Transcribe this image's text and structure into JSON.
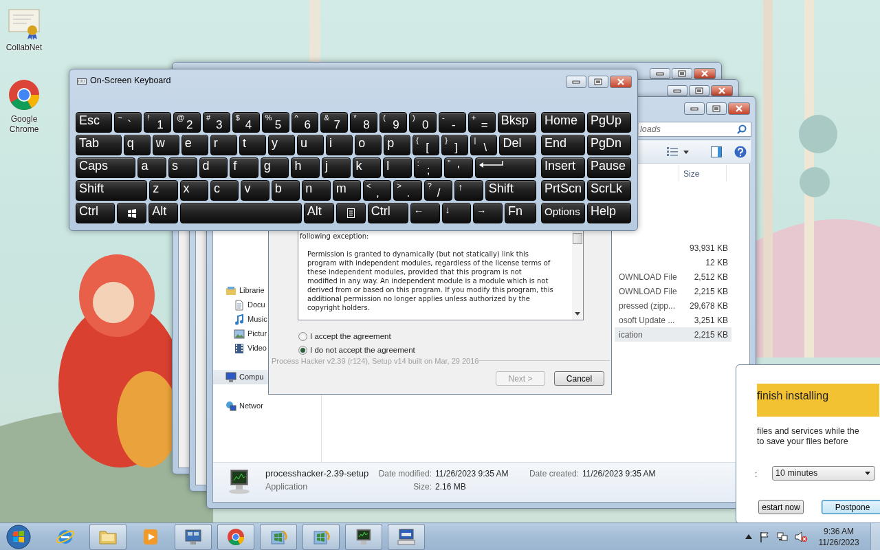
{
  "desktop_icons": [
    {
      "label": "CollabNet",
      "kind": "certificate"
    },
    {
      "label": "Google Chrome",
      "kind": "browser"
    }
  ],
  "explorer": {
    "search": {
      "value": "loads"
    },
    "column_header": "Size",
    "nav_items": [
      {
        "label": "Librarie",
        "kind": "library",
        "selected": false
      },
      {
        "label": "Docu",
        "kind": "document",
        "selected": false
      },
      {
        "label": "Music",
        "kind": "music",
        "selected": false
      },
      {
        "label": "Pictur",
        "kind": "picture",
        "selected": false
      },
      {
        "label": "Video",
        "kind": "video",
        "selected": false
      },
      {
        "label": "Compu",
        "kind": "computer",
        "selected": true
      },
      {
        "label": "Networ",
        "kind": "network",
        "selected": false
      }
    ],
    "files": [
      {
        "size": "93,931 KB",
        "selected": false
      },
      {
        "size": "12 KB",
        "selected": false
      },
      {
        "type": "OWNLOAD File",
        "size": "2,512 KB",
        "selected": false
      },
      {
        "type": "OWNLOAD File",
        "size": "2,215 KB",
        "selected": false
      },
      {
        "type": "pressed (zipp...",
        "size": "29,678 KB",
        "selected": false
      },
      {
        "type": "osoft Update ...",
        "size": "3,251 KB",
        "selected": false
      },
      {
        "type": "ication",
        "size": "2,215 KB",
        "selected": true
      }
    ],
    "details": {
      "name": "processhacker-2.39-setup",
      "type": "Application",
      "modified_label": "Date modified:",
      "modified": "11/26/2023 9:35 AM",
      "size_label": "Size:",
      "size": "2.16 MB",
      "created_label": "Date created:",
      "created": "11/26/2023 9:35 AM"
    }
  },
  "setup": {
    "license_intro": "following exception:",
    "license_text": "Permission is granted to dynamically (but not statically) link this program with independent modules, regardless of the license terms of these independent modules, provided that this program is not modified in any way. An independent module is a module which is not derived from or based on this program. If you modify this program, this additional permission no longer applies unless authorized by the copyright holders.",
    "options": [
      {
        "label": "I accept the agreement",
        "selected": false
      },
      {
        "label": "I do not accept the agreement",
        "selected": true
      }
    ],
    "version": "Process Hacker v2.39 (r124), Setup v14 built on Mar, 29 2016",
    "buttons": [
      {
        "label": "Next >",
        "disabled": true
      },
      {
        "label": "Cancel",
        "disabled": false
      }
    ]
  },
  "update": {
    "heading": "finish installing",
    "body_lines": [
      "files and services while the",
      "to save your files before"
    ],
    "select_label": ":",
    "select": "10 minutes",
    "buttons": [
      {
        "label": "estart now",
        "focused": false
      },
      {
        "label": "Postpone",
        "focused": true
      }
    ]
  },
  "keyboard": {
    "title": "On-Screen Keyboard",
    "main_rows": [
      [
        {
          "kind": "text",
          "label": "Esc"
        },
        {
          "kind": "dual",
          "shift": "~",
          "label": "`"
        },
        {
          "kind": "dual",
          "shift": "!",
          "label": "1"
        },
        {
          "kind": "dual",
          "shift": "@",
          "label": "2"
        },
        {
          "kind": "dual",
          "shift": "#",
          "label": "3"
        },
        {
          "kind": "dual",
          "shift": "$",
          "label": "4"
        },
        {
          "kind": "dual",
          "shift": "%",
          "label": "5"
        },
        {
          "kind": "dual",
          "shift": "^",
          "label": "6"
        },
        {
          "kind": "dual",
          "shift": "&",
          "label": "7"
        },
        {
          "kind": "dual",
          "shift": "*",
          "label": "8"
        },
        {
          "kind": "dual",
          "shift": "(",
          "label": "9"
        },
        {
          "kind": "dual",
          "shift": ")",
          "label": "0"
        },
        {
          "kind": "dual",
          "shift": "-",
          "label": "-"
        },
        {
          "kind": "dual",
          "shift": "+",
          "label": "="
        },
        {
          "kind": "text",
          "label": "Bksp"
        }
      ],
      [
        {
          "kind": "text",
          "label": "Tab"
        },
        {
          "kind": "text",
          "label": "q"
        },
        {
          "kind": "text",
          "label": "w"
        },
        {
          "kind": "text",
          "label": "e"
        },
        {
          "kind": "text",
          "label": "r"
        },
        {
          "kind": "text",
          "label": "t"
        },
        {
          "kind": "text",
          "label": "y"
        },
        {
          "kind": "text",
          "label": "u"
        },
        {
          "kind": "text",
          "label": "i"
        },
        {
          "kind": "text",
          "label": "o"
        },
        {
          "kind": "text",
          "label": "p"
        },
        {
          "kind": "dual",
          "shift": "{",
          "label": "["
        },
        {
          "kind": "dual",
          "shift": "}",
          "label": "]"
        },
        {
          "kind": "dual",
          "shift": "|",
          "label": "\\"
        },
        {
          "kind": "text",
          "label": "Del"
        }
      ],
      [
        {
          "kind": "text",
          "label": "Caps"
        },
        {
          "kind": "text",
          "label": "a"
        },
        {
          "kind": "text",
          "label": "s"
        },
        {
          "kind": "text",
          "label": "d"
        },
        {
          "kind": "text",
          "label": "f"
        },
        {
          "kind": "text",
          "label": "g"
        },
        {
          "kind": "text",
          "label": "h"
        },
        {
          "kind": "text",
          "label": "j"
        },
        {
          "kind": "text",
          "label": "k"
        },
        {
          "kind": "text",
          "label": "l"
        },
        {
          "kind": "dual",
          "shift": ":",
          "label": ";"
        },
        {
          "kind": "dual",
          "shift": "\"",
          "label": "'"
        },
        {
          "kind": "enter"
        }
      ],
      [
        {
          "kind": "text",
          "label": "Shift"
        },
        {
          "kind": "text",
          "label": "z"
        },
        {
          "kind": "text",
          "label": "x"
        },
        {
          "kind": "text",
          "label": "c"
        },
        {
          "kind": "text",
          "label": "v"
        },
        {
          "kind": "text",
          "label": "b"
        },
        {
          "kind": "text",
          "label": "n"
        },
        {
          "kind": "text",
          "label": "m"
        },
        {
          "kind": "dual",
          "shift": "<",
          "label": ","
        },
        {
          "kind": "dual",
          "shift": ">",
          "label": "."
        },
        {
          "kind": "dual",
          "shift": "?",
          "label": "/"
        },
        {
          "kind": "arrow",
          "label": "↑"
        },
        {
          "kind": "text",
          "label": "Shift"
        }
      ],
      [
        {
          "kind": "text",
          "label": "Ctrl"
        },
        {
          "kind": "windows"
        },
        {
          "kind": "text",
          "label": "Alt"
        },
        {
          "kind": "space"
        },
        {
          "kind": "text",
          "label": "Alt"
        },
        {
          "kind": "menu"
        },
        {
          "kind": "text",
          "label": "Ctrl"
        },
        {
          "kind": "arrow",
          "label": "←"
        },
        {
          "kind": "arrow",
          "label": "↓"
        },
        {
          "kind": "arrow",
          "label": "→"
        },
        {
          "kind": "text",
          "label": "Fn"
        }
      ]
    ],
    "nav_rows": [
      [
        {
          "kind": "text",
          "label": "Home"
        },
        {
          "kind": "text",
          "label": "PgUp"
        }
      ],
      [
        {
          "kind": "text",
          "label": "End"
        },
        {
          "kind": "text",
          "label": "PgDn"
        }
      ],
      [
        {
          "kind": "text",
          "label": "Insert"
        },
        {
          "kind": "text",
          "label": "Pause"
        }
      ],
      [
        {
          "kind": "text",
          "label": "PrtScn"
        },
        {
          "kind": "text",
          "label": "ScrLk"
        }
      ],
      [
        {
          "kind": "small",
          "label": "Options"
        },
        {
          "kind": "text",
          "label": "Help"
        }
      ]
    ]
  },
  "taskbar": {
    "items": [
      {
        "kind": "ie",
        "running": false
      },
      {
        "kind": "folder",
        "running": true
      },
      {
        "kind": "media",
        "running": false
      },
      {
        "kind": "control",
        "running": true
      },
      {
        "kind": "browser",
        "running": true
      },
      {
        "kind": "setup",
        "running": true
      },
      {
        "kind": "setup",
        "running": true
      },
      {
        "kind": "monitor",
        "running": true
      },
      {
        "kind": "keyboard",
        "running": true
      }
    ],
    "time": "9:36 AM",
    "date": "11/26/2023"
  }
}
